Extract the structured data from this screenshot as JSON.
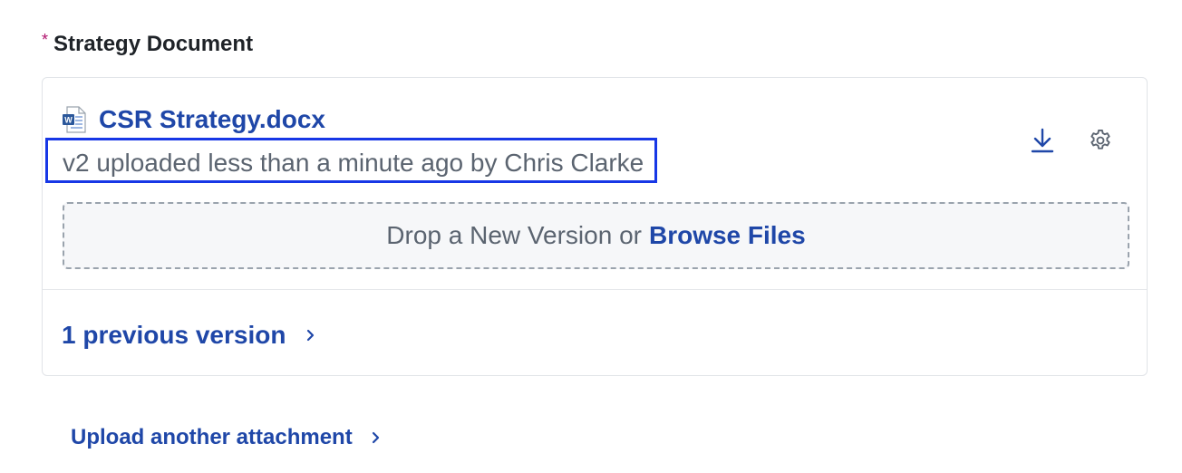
{
  "field": {
    "required_marker": "*",
    "label": "Strategy Document"
  },
  "file": {
    "icon": "word-document-icon",
    "name": "CSR Strategy.docx",
    "meta": "v2 uploaded less than a minute ago by Chris Clarke"
  },
  "actions": {
    "download_icon": "download-icon",
    "settings_icon": "gear-icon"
  },
  "dropzone": {
    "prefix": "Drop a New Version or",
    "browse_label": "Browse Files"
  },
  "versions": {
    "label": "1 previous version",
    "icon": "chevron-right-icon"
  },
  "upload_another": {
    "label": "Upload another attachment",
    "icon": "chevron-right-icon"
  },
  "colors": {
    "link": "#1f47a8",
    "required": "#b0126d",
    "highlight_border": "#1737e6",
    "muted_text": "#5b6470"
  }
}
